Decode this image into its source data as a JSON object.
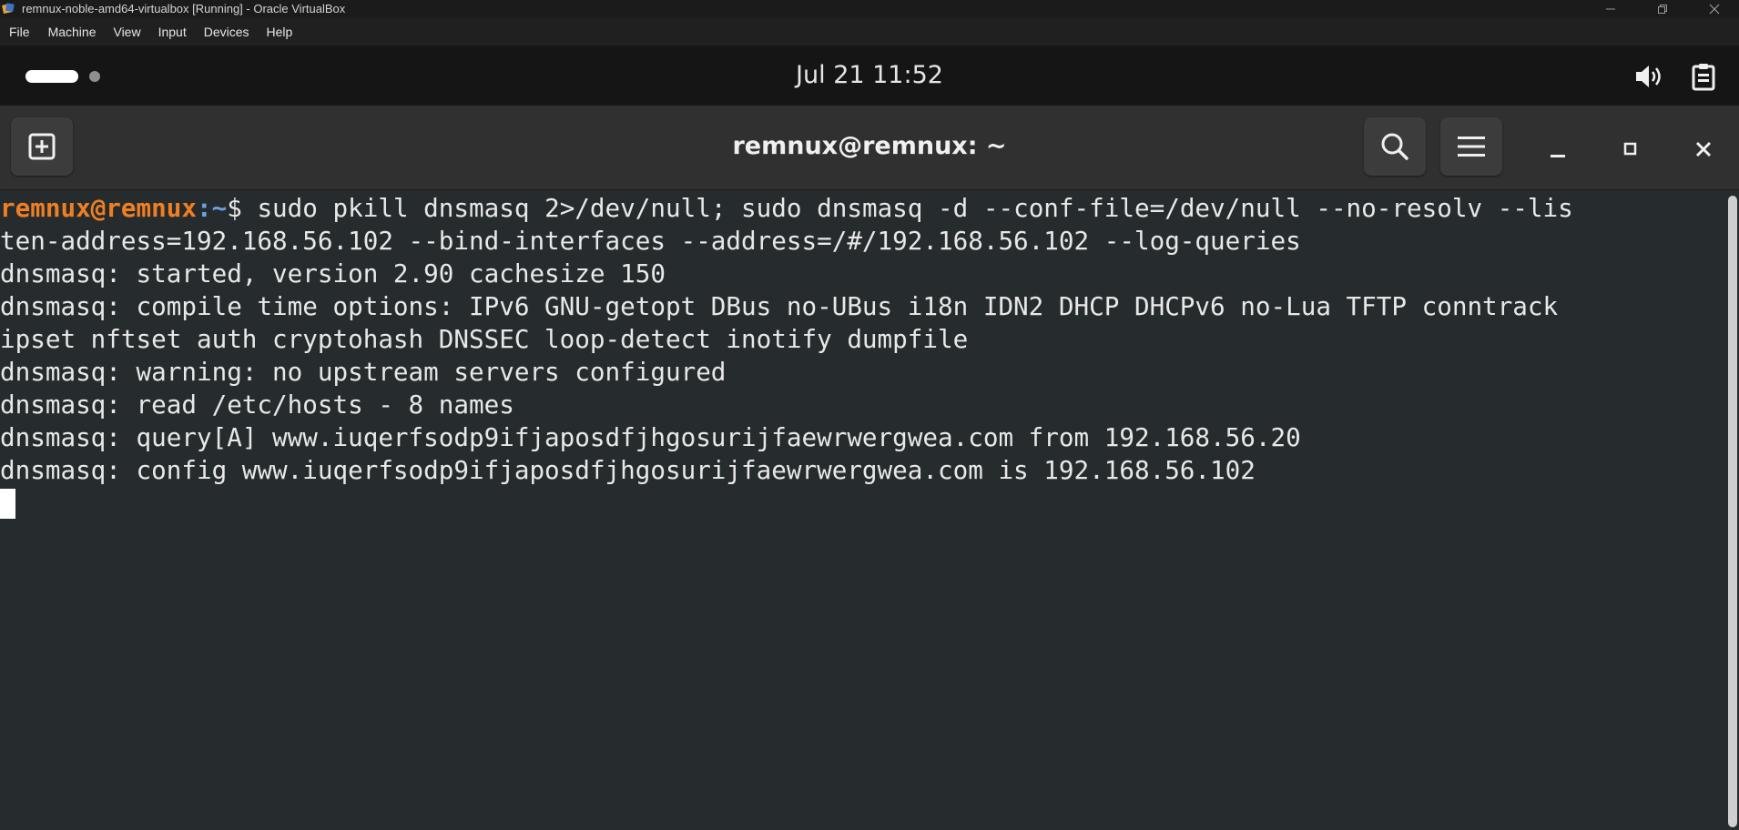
{
  "host_window": {
    "title": "remnux-noble-amd64-virtualbox [Running] - Oracle VirtualBox",
    "controls": [
      "minimize-icon",
      "restore-icon",
      "close-icon"
    ]
  },
  "host_menu": {
    "items": [
      "File",
      "Machine",
      "View",
      "Input",
      "Devices",
      "Help"
    ]
  },
  "gnome_topbar": {
    "clock": "Jul 21  11:52",
    "tray_icons": [
      "volume-icon",
      "clipboard-icon"
    ]
  },
  "terminal": {
    "title": "remnux@remnux: ~",
    "new_tab_icon": "new-tab-icon",
    "prompt": {
      "user_host": "remnux@remnux",
      "path": ":~",
      "sign": "$ "
    },
    "command_first": "sudo pkill dnsmasq 2>/dev/null; sudo dnsmasq -d --conf-file=/dev/null --no-resolv --lis",
    "lines": [
      "ten-address=192.168.56.102 --bind-interfaces --address=/#/192.168.56.102 --log-queries",
      "dnsmasq: started, version 2.90 cachesize 150",
      "dnsmasq: compile time options: IPv6 GNU-getopt DBus no-UBus i18n IDN2 DHCP DHCPv6 no-Lua TFTP conntrack",
      "ipset nftset auth cryptohash DNSSEC loop-detect inotify dumpfile",
      "dnsmasq: warning: no upstream servers configured",
      "dnsmasq: read /etc/hosts - 8 names",
      "dnsmasq: query[A] www.iuqerfsodp9ifjaposdfjhgosurijfaewrwergwea.com from 192.168.56.20",
      "dnsmasq: config www.iuqerfsodp9ifjaposdfjhgosurijfaewrwergwea.com is 192.168.56.102"
    ]
  },
  "colors": {
    "terminal_bg": "#262b2d",
    "prompt_user": "#f07f22",
    "prompt_path": "#6ca0dc",
    "header_bg": "#303030",
    "topbar_bg": "#151515"
  }
}
